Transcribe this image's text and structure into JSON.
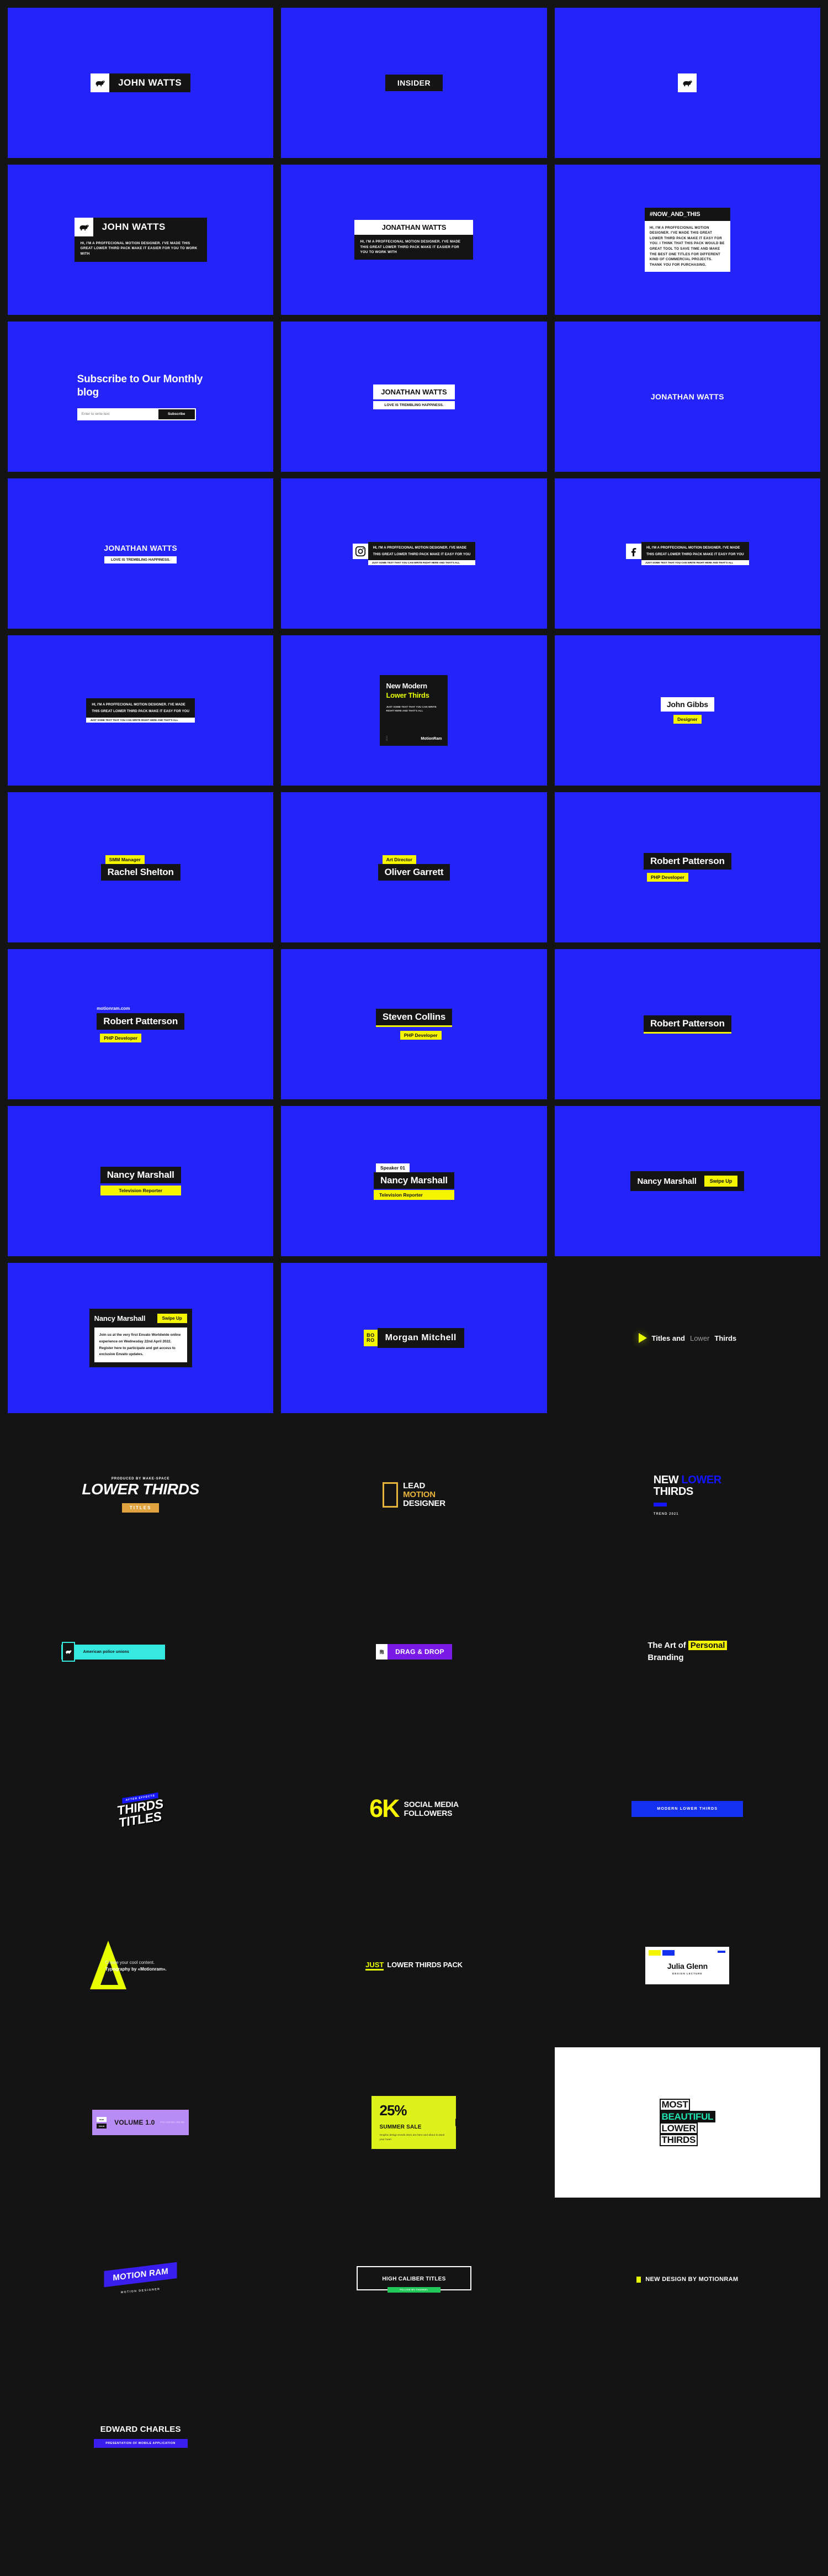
{
  "brand": {
    "name": "MotionRam",
    "site": "motionram.com"
  },
  "colors": {
    "blue": "#2323fa",
    "dark": "#141414",
    "yellow": "#f5f500",
    "lime": "#ddf21a",
    "cyan": "#35e8e0",
    "purple": "#7a1ae8",
    "violet": "#b98cf5",
    "orange": "#e0a33f",
    "green": "#22c95a",
    "deep_blue": "#1414ff"
  },
  "person": {
    "name": "JOHN WATTS",
    "insider": "INSIDER"
  },
  "bio_short": "HI, I'M A PROFFECIONAL MOTION DESIGNER. I'VE MADE THIS GREAT LOWER THIRD PACK MAKE IT  EASIER FOR YOU TO WORK WITH",
  "bio_long_title": "#NOW_AND_THIS",
  "bio_long": "HI, I'M A PROFFECIONAL MOTION DESIGNER. I'VE MADE THIS GREAT LOWER THIRD PACK MAKE IT EASY FOR YOU. I THINK THAT THIS PACK WOULD BE GREAT TOOL TO SAVE TIME AND MAKE THE BEST ONE TITLES FOR DIFFERENT KIND OF COMMERCIAL PROJECTS. THANK YOU FOR PURCHASING.",
  "social_line1": "HI, I'M A PROFFECIONAL MOTION DESIGNER. I'VE MADE",
  "social_line2": "THIS GREAT LOWER THIRD PACK MAKE IT EASY FOR YOU",
  "social_sub": "JUST SOME TEXT THAT YOU CAN WRITE RIGHT HERE AND THAT'S ALL",
  "subscribe": {
    "heading": "Subscribe to Our Monthly blog",
    "placeholder": "Enter to write text",
    "button": "Subscribe"
  },
  "jonathan": {
    "name": "JONATHAN WATTS",
    "tagline": "LOVE IS TREMBLING HAPPINESS."
  },
  "poster": {
    "line1": "New Modern",
    "line2": "Lower Thirds",
    "body": "JUST SOME TEXT THAT YOU CAN WRITE RIGHT HERE AND THAT'S ALL",
    "brand": "MotionRam",
    "side": "2021"
  },
  "people": [
    {
      "name": "John Gibbs",
      "role": "Designer"
    },
    {
      "name": "Rachel Shelton",
      "role": "SMM Manager"
    },
    {
      "name": "Oliver Garrett",
      "role": "Art Director"
    },
    {
      "name": "Robert Patterson",
      "role": "PHP Developer"
    },
    {
      "name": "Steven Collins",
      "role": "PHP Developer"
    },
    {
      "name": "Nancy Marshall",
      "role": "Television Reporter"
    },
    {
      "name": "Morgan Mitchell",
      "role": "BO RO"
    }
  ],
  "speaker_tag": "Speaker 01",
  "swipe_up": "Swipe Up",
  "announcement": "Join us at the very first Envato Worldwide online experience on Wednesday 22nd April 2022. Register here to participate and get access to exclusive Envato updates.",
  "boro": {
    "l1": "BO",
    "l2": "RO"
  },
  "header": {
    "t1": "Titles and",
    "t2": "Lower",
    "t3": "Thirds"
  },
  "lower_thirds_card": {
    "kicker": "PRODUCED BY MAKE-SPACE",
    "main": "LOWER THIRDS",
    "tag": "TITLES"
  },
  "lead_motion": {
    "a": "LEAD",
    "b": "MOTION",
    "c": "DESIGNER"
  },
  "new_lower_thirds": {
    "w1": "NEW",
    "w2": "LOWER",
    "w3": "THIRDS",
    "year": "TREND 2021"
  },
  "police": "American police unions",
  "drag_drop": {
    "icon": "拖",
    "label": "DRAG & DROP"
  },
  "art_of": {
    "a": "The Art of",
    "hl": "Personal",
    "b": "Branding"
  },
  "thirds_titles": {
    "kicker": "AFTER EFFECTS",
    "l1": "THIRDS",
    "l2": "TITLES"
  },
  "followers": {
    "number": "6K",
    "l1": "SOCIAL MEDIA",
    "l2": "FOLLOWERS"
  },
  "modern_button": "MODERN LOWER THIRDS",
  "typography": {
    "a": "Create your cool content.",
    "b": "Typography by «Motionram»."
  },
  "just_pack": {
    "a": "JUST",
    "b": "LOWER THIRDS PACK"
  },
  "julia": {
    "name": "Julia Glenn",
    "role": "DESIGN LECTURE"
  },
  "volume": {
    "title": "VOLUME 1.0",
    "c1": "mon",
    "c2": "trend",
    "follow": "FOLLOW ME LIKE ME"
  },
  "summer_sale": {
    "percent": "25%",
    "heading": "SUMMER SALE",
    "desc": "Graphic design trends 2021 are here and about to steal your heart"
  },
  "most_beautiful": {
    "a": "MOST",
    "b": "BEAUTIFUL",
    "c": "LOWER",
    "d": "THIRDS"
  },
  "motion_ram": {
    "tag": "MOTION RAM",
    "sub": "MOTION DESIGNER"
  },
  "high_caliber": {
    "title": "HIGH CALIBER TITLES",
    "pill": "FOLLOW MY CHANNEL"
  },
  "new_design": "NEW DESIGN BY MOTIONRAM",
  "edward": {
    "name": "EDWARD CHARLES",
    "sub": "PRESENTATION OF MOBILE APPLICATION"
  }
}
